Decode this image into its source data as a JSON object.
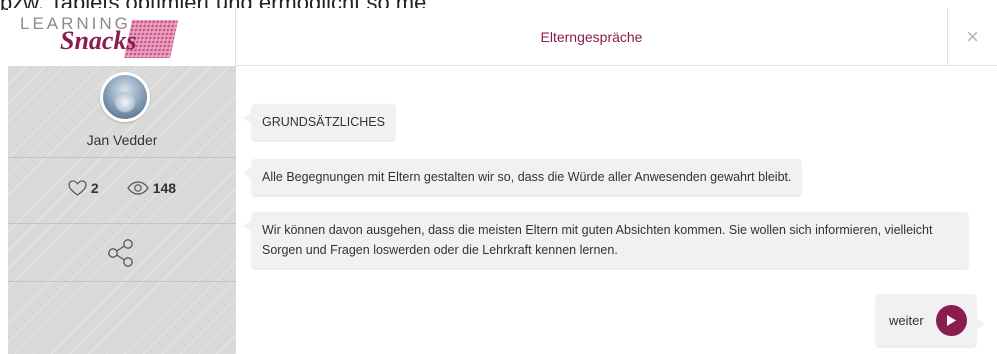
{
  "background": {
    "partial_text": "bzw. Tablets optimiert und ermöglicht so me"
  },
  "logo": {
    "line1": "LEARNING",
    "line2": "Snacks"
  },
  "header": {
    "title": "Elterngespräche",
    "close_symbol": "×"
  },
  "sidebar": {
    "author_name": "Jan Vedder",
    "likes": "2",
    "views": "148"
  },
  "chat": {
    "messages": [
      "GRUNDSÄTZLICHES",
      "Alle Begegnungen mit Eltern gestalten wir so, dass die Würde aller Anwesenden gewahrt bleibt.",
      "Wir können davon ausgehen, dass die meisten Eltern mit guten Absichten kommen. Sie wollen sich informieren, vielleicht Sorgen und Fragen loswerden oder die Lehrkraft kennen lernen."
    ],
    "continue_label": "weiter"
  },
  "colors": {
    "accent": "#8b1d4e",
    "sidebar_bg": "#d9d9d9",
    "bubble_bg": "#f1f1f1"
  }
}
